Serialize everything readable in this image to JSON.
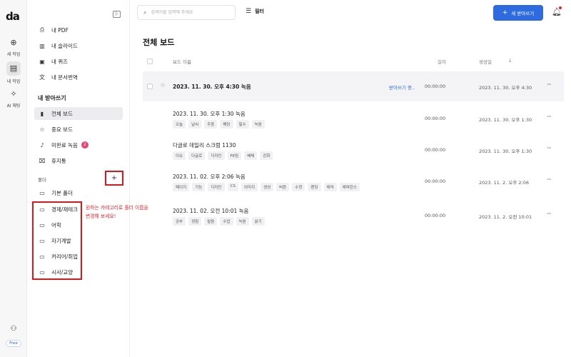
{
  "rail": {
    "logo": "da",
    "items": [
      {
        "icon": "plus-circle-icon",
        "glyph": "⊕",
        "label": "새 작업"
      },
      {
        "icon": "folder-icon",
        "glyph": "▤",
        "label": "내 작업"
      },
      {
        "icon": "ai-chat-icon",
        "glyph": "✧",
        "label": "AI 채팅"
      }
    ],
    "plan_badge": "Free"
  },
  "sidebar": {
    "tools": [
      {
        "icon": "pdf-icon",
        "glyph": "⎙",
        "label": "내 PDF"
      },
      {
        "icon": "slides-icon",
        "glyph": "▥",
        "label": "내 슬라이드"
      },
      {
        "icon": "quiz-icon",
        "glyph": "▣",
        "label": "내 퀴즈"
      },
      {
        "icon": "translate-icon",
        "glyph": "文",
        "label": "내 문서번역"
      }
    ],
    "section_title": "내 받아쓰기",
    "boards": [
      {
        "icon": "board-icon",
        "glyph": "▮",
        "label": "전체 보드",
        "active": true
      },
      {
        "icon": "star-icon",
        "glyph": "☆",
        "label": "중요 보드"
      },
      {
        "icon": "mic-icon",
        "glyph": "♪",
        "label": "미완료 녹음",
        "badge": "2"
      },
      {
        "icon": "trash-icon",
        "glyph": "🗑",
        "label": "휴지통"
      }
    ],
    "folder_label": "폴더",
    "add_folder": "+",
    "folders": [
      "기본 폴더",
      "경제/재테크",
      "어학",
      "자기계발",
      "커리어/취업",
      "시사/교양"
    ],
    "callout": "원하는 카테고리로 폴더 이름을 변경해 보세요!"
  },
  "header": {
    "search_placeholder": "검색어를 입력해 주세요",
    "filter_label": "필터",
    "new_button": "새 받아쓰기"
  },
  "main": {
    "title": "전체 보드",
    "columns": {
      "name": "보드 이름",
      "duration": "길이",
      "created": "생성일",
      "sort": "↓"
    },
    "rows": [
      {
        "title": "2023. 11. 30. 오후 4:30 녹음",
        "tags": [],
        "status": "받아쓰기 중..",
        "duration": "00:00:00",
        "created": "2023. 11. 30. 오후 4:30"
      },
      {
        "title": "2023. 11. 30. 오후 1:30 녹음",
        "tags": [
          "오늘",
          "날씨",
          "주중",
          "해당",
          "필수",
          "녹음"
        ],
        "status": "",
        "duration": "00:00:00",
        "created": "2023. 11. 30. 오후 1:30"
      },
      {
        "title": "다글로 데일리 스크럼 1130",
        "tags": [
          "이슈",
          "다글로",
          "디자인",
          "FE팀",
          "배체",
          "강화"
        ],
        "status": "",
        "duration": "00:00:00",
        "created": "2023. 11. 30. 오후 1:30"
      },
      {
        "title": "2023. 11. 02. 오후 2:06 녹음",
        "tags": [
          "페이지",
          "기능",
          "디자인",
          "CS",
          "이미지",
          "생성",
          "버튼",
          "수정",
          "랜딩",
          "테마",
          "레퍼런스"
        ],
        "status": "",
        "duration": "00:00:00",
        "created": "2023. 11. 2. 오후 2:06"
      },
      {
        "title": "2023. 11. 02. 오전 10:01 녹음",
        "tags": [
          "공부",
          "경험",
          "발음",
          "수업",
          "녹음",
          "읽기"
        ],
        "status": "",
        "duration": "00:00:00",
        "created": "2023. 11. 2. 오전 10:01"
      }
    ]
  }
}
